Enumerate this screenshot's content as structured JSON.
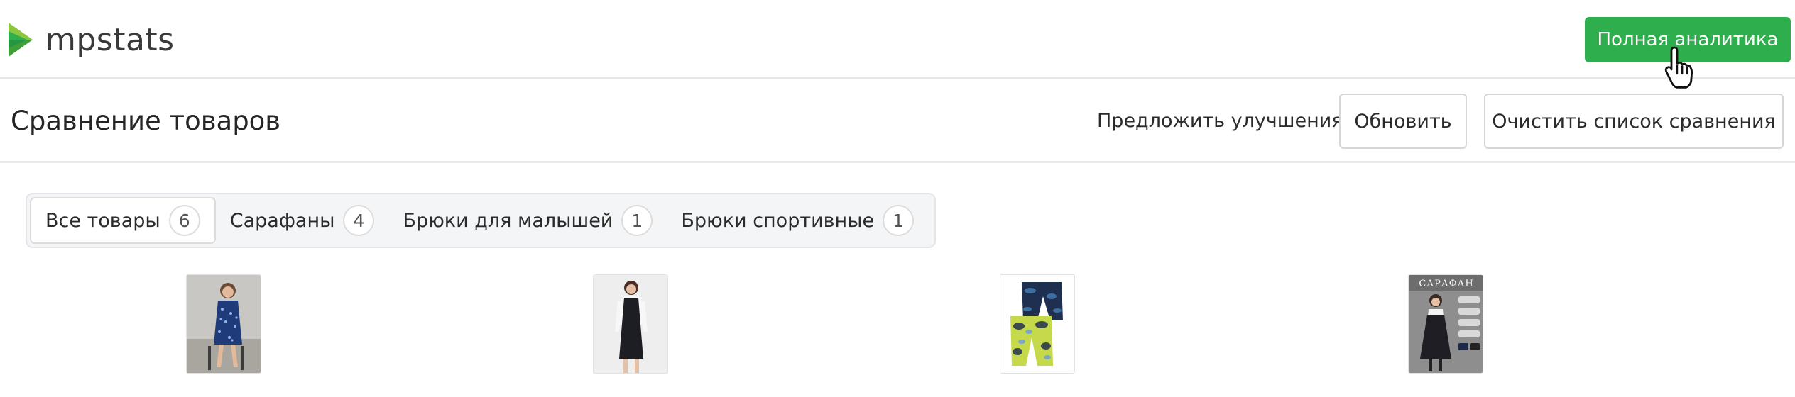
{
  "brand": {
    "name": "mpstats",
    "logo_icon": "play-triangles-icon",
    "accent": "#2fae4e"
  },
  "topbar": {
    "analytics_button": "Полная аналитика"
  },
  "header": {
    "title": "Сравнение товаров",
    "suggest_link": "Предложить улучшения",
    "refresh_button": "Обновить",
    "clear_button": "Очистить список сравнения"
  },
  "tabs": [
    {
      "label": "Все товары",
      "count": "6",
      "active": true
    },
    {
      "label": "Сарафаны",
      "count": "4",
      "active": false
    },
    {
      "label": "Брюки для малышей",
      "count": "1",
      "active": false
    },
    {
      "label": "Брюки спортивные",
      "count": "1",
      "active": false
    }
  ],
  "products": [
    {
      "image": "blue-floral-dress-photo"
    },
    {
      "image": "black-pinafore-dress-photo"
    },
    {
      "image": "camouflage-kids-pants-photo"
    },
    {
      "image": "school-sarafan-photo",
      "caption": "САРАФАН"
    }
  ]
}
